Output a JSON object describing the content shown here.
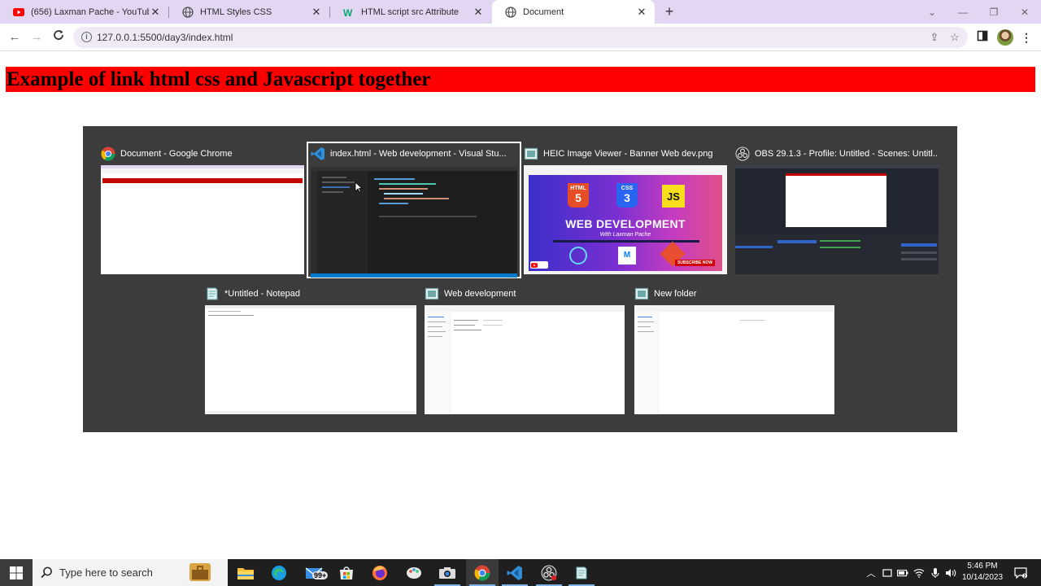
{
  "browser": {
    "tabs": [
      {
        "title": "(656) Laxman Pache - YouTube",
        "favicon": "youtube-icon",
        "active": false
      },
      {
        "title": "HTML Styles CSS",
        "favicon": "globe-icon",
        "active": false
      },
      {
        "title": "HTML script src Attribute",
        "favicon": "w3schools-icon",
        "active": false
      },
      {
        "title": "Document",
        "favicon": "globe-icon",
        "active": true
      }
    ],
    "url": "127.0.0.1:5500/day3/index.html",
    "accent": "#e3d6f3"
  },
  "page": {
    "heading": "Example of link html css and Javascript together",
    "heading_bg": "#ff0000"
  },
  "switcher": {
    "windows": [
      {
        "title": "Document - Google Chrome",
        "icon": "chrome-icon"
      },
      {
        "title": "index.html - Web development - Visual Stu...",
        "icon": "vscode-icon",
        "selected": true
      },
      {
        "title": "HEIC Image Viewer - Banner Web dev.png",
        "icon": "image-viewer-icon"
      },
      {
        "title": "OBS 29.1.3 - Profile: Untitled - Scenes: Untitl...",
        "icon": "obs-icon"
      },
      {
        "title": "*Untitled - Notepad",
        "icon": "notepad-icon"
      },
      {
        "title": "Web development",
        "icon": "folder-window-icon"
      },
      {
        "title": "New folder",
        "icon": "folder-window-icon"
      }
    ],
    "banner": {
      "html": "HTML",
      "css": "CSS",
      "js": "JS",
      "title": "WEB DEVELOPMENT",
      "subtitle": "With Laxman Pache",
      "subscribe": "SUBSCRIBE NOW"
    }
  },
  "taskbar": {
    "search_placeholder": "Type here to search",
    "mail_badge": "99+",
    "time": "5:46 PM",
    "date": "10/14/2023"
  }
}
